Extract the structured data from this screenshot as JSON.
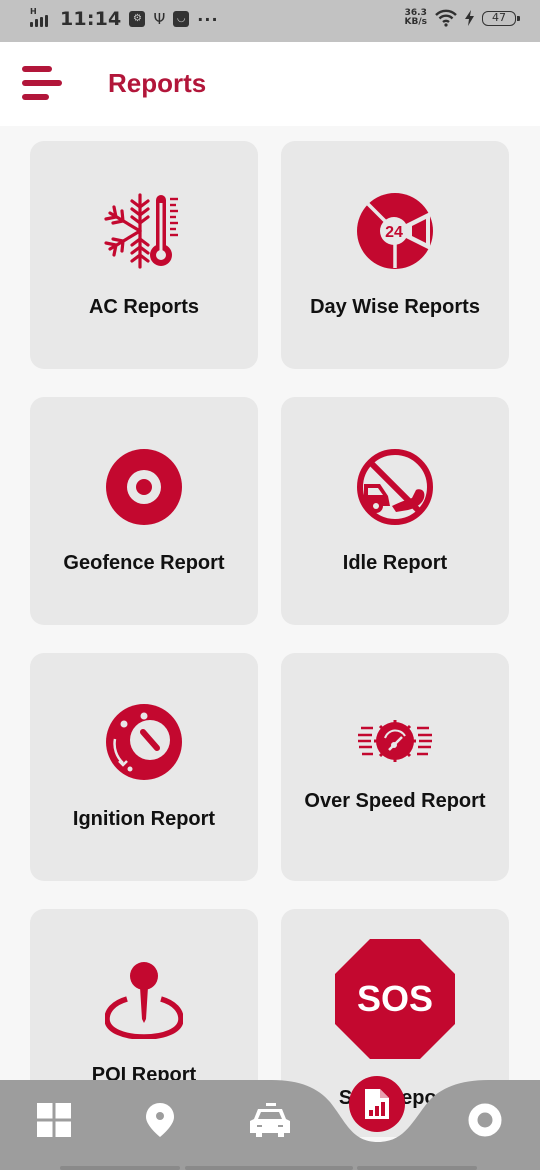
{
  "status_bar": {
    "network": "H",
    "time": "11:14",
    "speed_value": "36.3",
    "speed_unit": "KB/s",
    "battery": "47",
    "more": "···"
  },
  "header": {
    "title": "Reports",
    "menu_icon": "hamburger-menu-icon"
  },
  "colors": {
    "accent": "#b2163a",
    "icon_red": "#c3082f",
    "card_bg": "#e8e8e8",
    "nav_bg": "#9d9d9d"
  },
  "reports": [
    {
      "label": "AC Reports",
      "icon": "snowflake-thermometer-icon"
    },
    {
      "label": "Day Wise Reports",
      "icon": "24-hour-clock-icon"
    },
    {
      "label": "Geofence Report",
      "icon": "target-icon"
    },
    {
      "label": "Idle Report",
      "icon": "no-idling-icon"
    },
    {
      "label": "Ignition Report",
      "icon": "ignition-knob-icon"
    },
    {
      "label": "Over Speed Report",
      "icon": "speedometer-icon"
    },
    {
      "label": "POI Report",
      "icon": "map-pin-icon"
    },
    {
      "label": "SOS Report",
      "icon": "sos-sign-icon"
    }
  ],
  "bottom_nav": [
    {
      "name": "dashboard",
      "icon": "grid-icon"
    },
    {
      "name": "location",
      "icon": "location-pin-icon"
    },
    {
      "name": "vehicles",
      "icon": "car-icon"
    },
    {
      "name": "reports",
      "icon": "report-chart-icon",
      "active": true
    },
    {
      "name": "more",
      "icon": "ring-icon"
    }
  ]
}
